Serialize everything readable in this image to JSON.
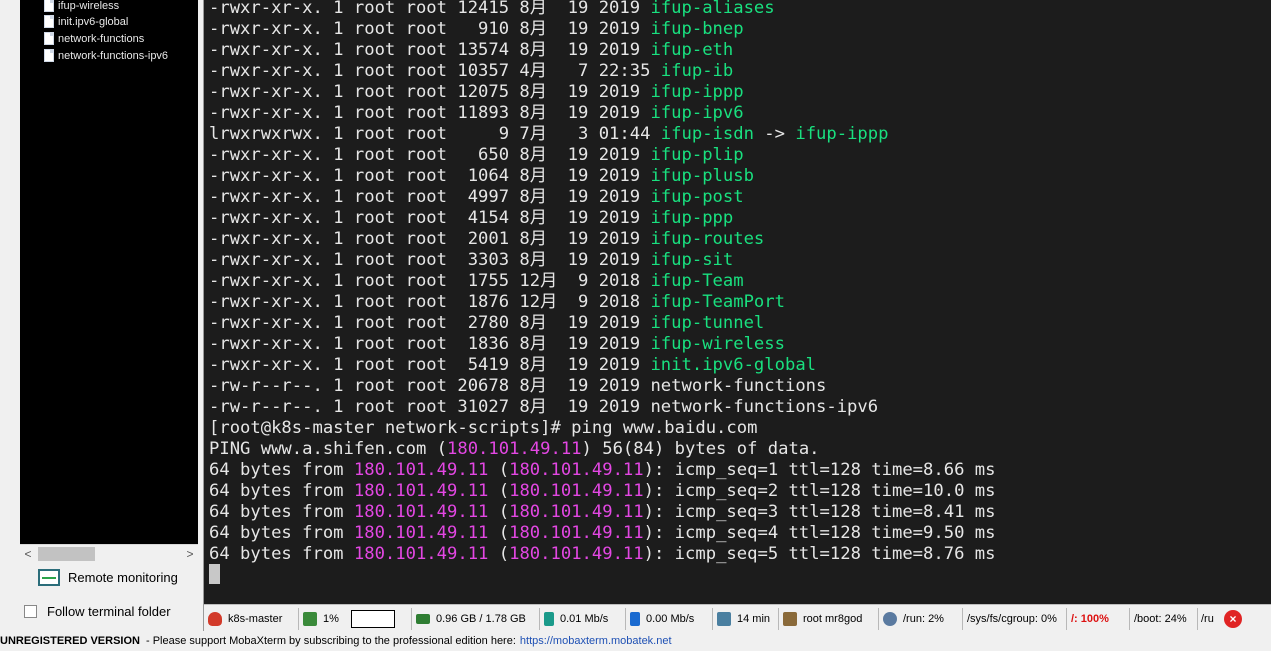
{
  "sidebar": {
    "tree_items": [
      "ifup-wireless",
      "init.ipv6-global",
      "network-functions",
      "network-functions-ipv6"
    ],
    "remote_monitoring_label": "Remote monitoring",
    "follow_folder_label": "Follow terminal folder",
    "scroll_left": "<",
    "scroll_right": ">"
  },
  "terminal": {
    "lines": [
      [
        {
          "t": "-rwxr-xr-x. 1 root root 12415 8月  19 2019 "
        },
        {
          "t": "ifup-aliases",
          "c": "green"
        }
      ],
      [
        {
          "t": "-rwxr-xr-x. 1 root root   910 8月  19 2019 "
        },
        {
          "t": "ifup-bnep",
          "c": "green"
        }
      ],
      [
        {
          "t": "-rwxr-xr-x. 1 root root 13574 8月  19 2019 "
        },
        {
          "t": "ifup-eth",
          "c": "green"
        }
      ],
      [
        {
          "t": "-rwxr-xr-x. 1 root root 10357 4月   7 22:35 "
        },
        {
          "t": "ifup-ib",
          "c": "green"
        }
      ],
      [
        {
          "t": "-rwxr-xr-x. 1 root root 12075 8月  19 2019 "
        },
        {
          "t": "ifup-ippp",
          "c": "green"
        }
      ],
      [
        {
          "t": "-rwxr-xr-x. 1 root root 11893 8月  19 2019 "
        },
        {
          "t": "ifup-ipv6",
          "c": "green"
        }
      ],
      [
        {
          "t": "lrwxrwxrwx. 1 root root     9 7月   3 01:44 "
        },
        {
          "t": "ifup-isdn",
          "c": "green"
        },
        {
          "t": " -> "
        },
        {
          "t": "ifup-ippp",
          "c": "green"
        }
      ],
      [
        {
          "t": "-rwxr-xr-x. 1 root root   650 8月  19 2019 "
        },
        {
          "t": "ifup-plip",
          "c": "green"
        }
      ],
      [
        {
          "t": "-rwxr-xr-x. 1 root root  1064 8月  19 2019 "
        },
        {
          "t": "ifup-plusb",
          "c": "green"
        }
      ],
      [
        {
          "t": "-rwxr-xr-x. 1 root root  4997 8月  19 2019 "
        },
        {
          "t": "ifup-post",
          "c": "green"
        }
      ],
      [
        {
          "t": "-rwxr-xr-x. 1 root root  4154 8月  19 2019 "
        },
        {
          "t": "ifup-ppp",
          "c": "green"
        }
      ],
      [
        {
          "t": "-rwxr-xr-x. 1 root root  2001 8月  19 2019 "
        },
        {
          "t": "ifup-routes",
          "c": "green"
        }
      ],
      [
        {
          "t": "-rwxr-xr-x. 1 root root  3303 8月  19 2019 "
        },
        {
          "t": "ifup-sit",
          "c": "green"
        }
      ],
      [
        {
          "t": "-rwxr-xr-x. 1 root root  1755 12月  9 2018 "
        },
        {
          "t": "ifup-Team",
          "c": "green"
        }
      ],
      [
        {
          "t": "-rwxr-xr-x. 1 root root  1876 12月  9 2018 "
        },
        {
          "t": "ifup-TeamPort",
          "c": "green"
        }
      ],
      [
        {
          "t": "-rwxr-xr-x. 1 root root  2780 8月  19 2019 "
        },
        {
          "t": "ifup-tunnel",
          "c": "green"
        }
      ],
      [
        {
          "t": "-rwxr-xr-x. 1 root root  1836 8月  19 2019 "
        },
        {
          "t": "ifup-wireless",
          "c": "green"
        }
      ],
      [
        {
          "t": "-rwxr-xr-x. 1 root root  5419 8月  19 2019 "
        },
        {
          "t": "init.ipv6-global",
          "c": "green"
        }
      ],
      [
        {
          "t": "-rw-r--r--. 1 root root 20678 8月  19 2019 network-functions"
        }
      ],
      [
        {
          "t": "-rw-r--r--. 1 root root 31027 8月  19 2019 network-functions-ipv6"
        }
      ],
      [
        {
          "t": "[root@k8s-master network-scripts]# ping www.baidu.com"
        }
      ],
      [
        {
          "t": "PING www.a.shifen.com ("
        },
        {
          "t": "180.101.49.11",
          "c": "mag"
        },
        {
          "t": ") 56(84) bytes of data."
        }
      ],
      [
        {
          "t": "64 bytes from "
        },
        {
          "t": "180.101.49.11",
          "c": "mag"
        },
        {
          "t": " ("
        },
        {
          "t": "180.101.49.11",
          "c": "mag"
        },
        {
          "t": "): icmp_seq=1 ttl=128 time=8.66 ms"
        }
      ],
      [
        {
          "t": "64 bytes from "
        },
        {
          "t": "180.101.49.11",
          "c": "mag"
        },
        {
          "t": " ("
        },
        {
          "t": "180.101.49.11",
          "c": "mag"
        },
        {
          "t": "): icmp_seq=2 ttl=128 time=10.0 ms"
        }
      ],
      [
        {
          "t": "64 bytes from "
        },
        {
          "t": "180.101.49.11",
          "c": "mag"
        },
        {
          "t": " ("
        },
        {
          "t": "180.101.49.11",
          "c": "mag"
        },
        {
          "t": "): icmp_seq=3 ttl=128 time=8.41 ms"
        }
      ],
      [
        {
          "t": "64 bytes from "
        },
        {
          "t": "180.101.49.11",
          "c": "mag"
        },
        {
          "t": " ("
        },
        {
          "t": "180.101.49.11",
          "c": "mag"
        },
        {
          "t": "): icmp_seq=4 ttl=128 time=9.50 ms"
        }
      ],
      [
        {
          "t": "64 bytes from "
        },
        {
          "t": "180.101.49.11",
          "c": "mag"
        },
        {
          "t": " ("
        },
        {
          "t": "180.101.49.11",
          "c": "mag"
        },
        {
          "t": "): icmp_seq=5 ttl=128 time=8.76 ms"
        }
      ]
    ]
  },
  "statusbar": {
    "host": "k8s-master",
    "cpu": "1%",
    "memory": "0.96 GB / 1.78 GB",
    "upload": "0.01 Mb/s",
    "download": "0.00 Mb/s",
    "uptime": "14 min",
    "user": "root  mr8god",
    "disk_run": "/run: 2%",
    "disk_cgroup": "/sys/fs/cgroup: 0%",
    "disk_root": "/: 100%",
    "disk_boot": "/boot: 24%",
    "disk_more": "/ru",
    "close": "×"
  },
  "banner": {
    "label": "UNREGISTERED VERSION",
    "text": " -  Please support MobaXterm by subscribing to the professional edition here: ",
    "link": "https://mobaxterm.mobatek.net"
  },
  "colors": {
    "terminal_bg": "#1c1c1c",
    "green_file": "#19e07f",
    "ip_magenta": "#e347e3",
    "disk_full": "#dd1111"
  }
}
